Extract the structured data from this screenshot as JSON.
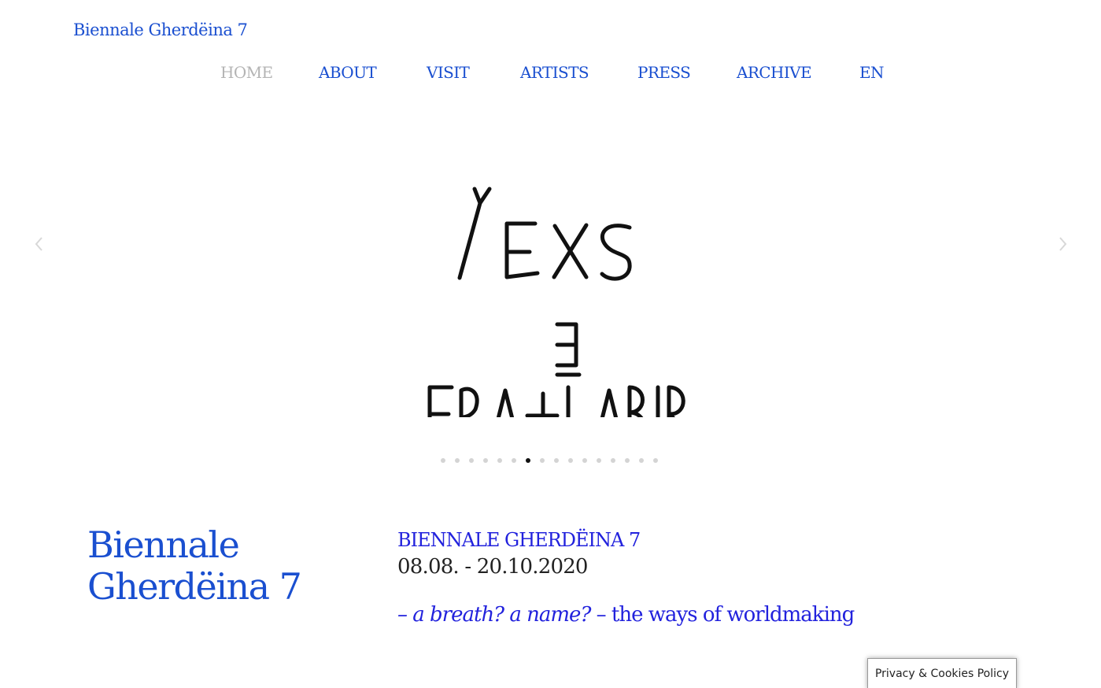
{
  "site": {
    "logo": "Biennale Gherdëina 7"
  },
  "nav": {
    "items": [
      {
        "label": "HOME"
      },
      {
        "label": "ABOUT"
      },
      {
        "label": "VISIT"
      },
      {
        "label": "ARTISTS"
      },
      {
        "label": "PRESS"
      },
      {
        "label": "ARCHIVE"
      },
      {
        "label": "EN"
      }
    ],
    "active_index": 0
  },
  "slider": {
    "slide_count": 16,
    "active_slide": 6,
    "artwork_lines": [
      "SEXY",
      "E",
      "RIBALTARE"
    ]
  },
  "intro": {
    "title_line1": "Biennale",
    "title_line2": "Gherdëina 7",
    "heading": "BIENNALE GHERDËINA 7",
    "dates": "08.08. - 20.10.2020",
    "tagline_italic": "– a breath? a name? ",
    "tagline_rest": "– the ways of worldmaking"
  },
  "cookie": {
    "label": "Privacy & Cookies Policy"
  },
  "colors": {
    "brand_blue": "#1a4fd0",
    "accent_blue": "#2222dd",
    "nav_active": "#b4b4b4"
  }
}
